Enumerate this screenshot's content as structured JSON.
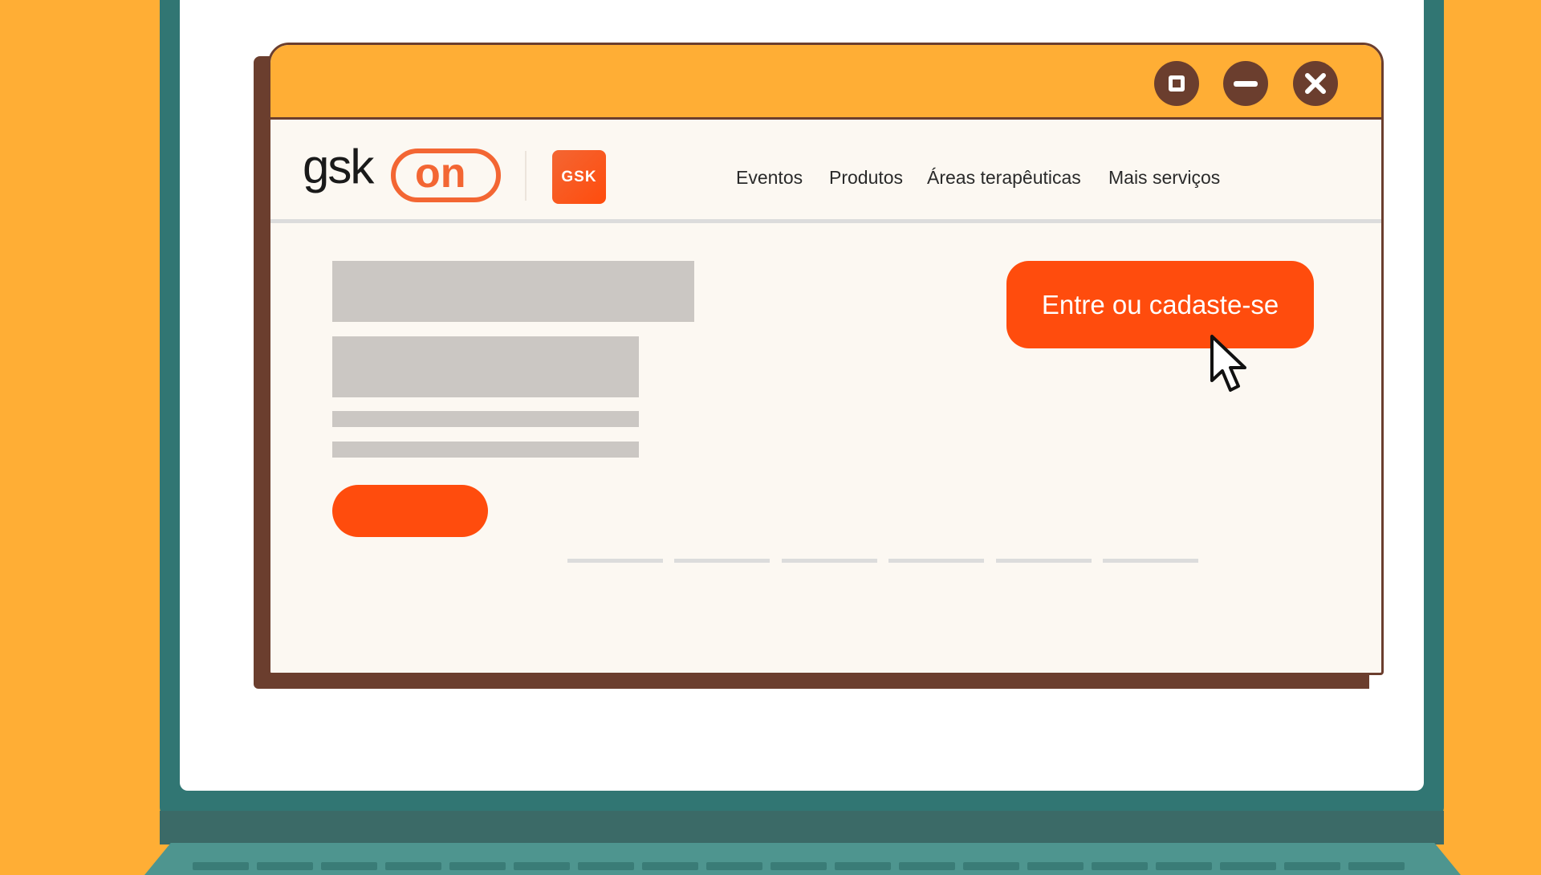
{
  "window": {
    "controls": [
      {
        "name": "maximize-icon"
      },
      {
        "name": "minimize-icon"
      },
      {
        "name": "close-icon"
      }
    ]
  },
  "header": {
    "logo_text": "gsk",
    "logo_on": "on",
    "badge_text": "GSK",
    "nav": [
      "Eventos",
      "Produtos",
      "Áreas terapêuticas",
      "Mais serviços"
    ]
  },
  "main": {
    "cta_label": "Entre ou cadaste-se"
  },
  "colors": {
    "background": "#FFAE35",
    "window_border": "#6B3E2E",
    "accent": "#FF4C0D",
    "brand_orange": "#F36633",
    "laptop": "#317673"
  }
}
